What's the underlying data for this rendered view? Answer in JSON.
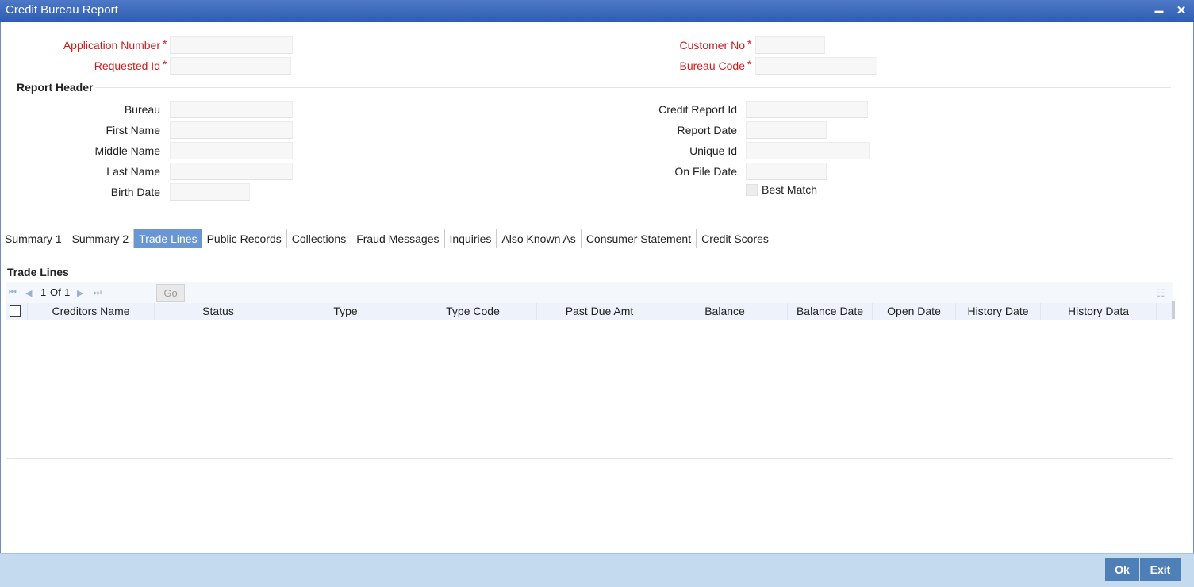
{
  "window": {
    "title": "Credit Bureau Report",
    "minimize_glyph": "▬",
    "close_glyph": "✕"
  },
  "top_fields": {
    "application_number_label": "Application Number",
    "requested_id_label": "Requested Id",
    "customer_no_label": "Customer No",
    "bureau_code_label": "Bureau Code",
    "required_marker": "*"
  },
  "report_header": {
    "title": "Report Header",
    "bureau_label": "Bureau",
    "first_name_label": "First Name",
    "middle_name_label": "Middle Name",
    "last_name_label": "Last Name",
    "birth_date_label": "Birth Date",
    "credit_report_id_label": "Credit Report Id",
    "report_date_label": "Report Date",
    "unique_id_label": "Unique Id",
    "on_file_date_label": "On File Date",
    "best_match_label": "Best Match"
  },
  "tabs": [
    {
      "label": "Summary 1",
      "active": false
    },
    {
      "label": "Summary 2",
      "active": false
    },
    {
      "label": "Trade Lines",
      "active": true
    },
    {
      "label": "Public Records",
      "active": false
    },
    {
      "label": "Collections",
      "active": false
    },
    {
      "label": "Fraud Messages",
      "active": false
    },
    {
      "label": "Inquiries",
      "active": false
    },
    {
      "label": "Also Known As",
      "active": false
    },
    {
      "label": "Consumer Statement",
      "active": false
    },
    {
      "label": "Credit Scores",
      "active": false
    }
  ],
  "trade_lines": {
    "title": "Trade Lines",
    "page_current": "1",
    "page_of": "Of",
    "page_total": "1",
    "go_label": "Go",
    "columns": [
      "Creditors Name",
      "Status",
      "Type",
      "Type Code",
      "Past Due Amt",
      "Balance",
      "Balance Date",
      "Open Date",
      "History Date",
      "History Data"
    ]
  },
  "footer": {
    "ok_label": "Ok",
    "exit_label": "Exit"
  },
  "colors": {
    "title_bar": "#2e5cb0",
    "required_label": "#d11a1a",
    "active_tab": "#6b96d6",
    "footer_bar": "#c3daef",
    "footer_button": "#4e7fb6"
  },
  "icons": {
    "first_page": "first-page-icon",
    "prev_page": "prev-page-icon",
    "next_page": "next-page-icon",
    "last_page": "last-page-icon",
    "columns": "column-list-icon"
  }
}
